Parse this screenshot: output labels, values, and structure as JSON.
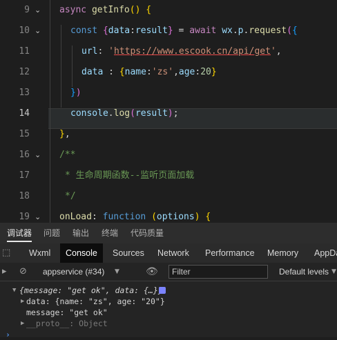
{
  "editor": {
    "lines": [
      {
        "number": "9",
        "segments": [
          [
            "kw",
            "async"
          ],
          [
            "plain",
            " "
          ],
          [
            "fn",
            "getInfo"
          ],
          [
            "br1",
            "()"
          ],
          [
            "plain",
            " "
          ],
          [
            "br1",
            "{"
          ]
        ]
      },
      {
        "number": "10",
        "segments": [
          [
            "kw2",
            "const"
          ],
          [
            "plain",
            " "
          ],
          [
            "br2",
            "{"
          ],
          [
            "var",
            "data"
          ],
          [
            "plain",
            ":"
          ],
          [
            "var",
            "result"
          ],
          [
            "br2",
            "}"
          ],
          [
            "plain",
            " = "
          ],
          [
            "kw",
            "await"
          ],
          [
            "plain",
            " "
          ],
          [
            "var",
            "wx"
          ],
          [
            "plain",
            "."
          ],
          [
            "var",
            "p"
          ],
          [
            "plain",
            "."
          ],
          [
            "fn",
            "request"
          ],
          [
            "br2",
            "("
          ],
          [
            "br3",
            "{"
          ]
        ]
      },
      {
        "number": "11",
        "segments": [
          [
            "var",
            "url"
          ],
          [
            "plain",
            ": "
          ],
          [
            "str",
            "'"
          ],
          [
            "url",
            "https://www.escook.cn/api/get"
          ],
          [
            "str",
            "'"
          ],
          [
            "plain",
            ","
          ]
        ]
      },
      {
        "number": "12",
        "segments": [
          [
            "var",
            "data"
          ],
          [
            "plain",
            " : "
          ],
          [
            "br1",
            "{"
          ],
          [
            "var",
            "name"
          ],
          [
            "plain",
            ":"
          ],
          [
            "str",
            "'zs'"
          ],
          [
            "plain",
            ","
          ],
          [
            "var",
            "age"
          ],
          [
            "plain",
            ":"
          ],
          [
            "num",
            "20"
          ],
          [
            "br1",
            "}"
          ]
        ]
      },
      {
        "number": "13",
        "segments": [
          [
            "br3",
            "}"
          ],
          [
            "br2",
            ")"
          ]
        ]
      },
      {
        "number": "14",
        "segments": [
          [
            "var",
            "console"
          ],
          [
            "plain",
            "."
          ],
          [
            "fn",
            "log"
          ],
          [
            "br2",
            "("
          ],
          [
            "var",
            "result"
          ],
          [
            "br2",
            ")"
          ],
          [
            "plain",
            ";"
          ]
        ]
      },
      {
        "number": "15",
        "segments": [
          [
            "br1",
            "}"
          ],
          [
            "plain",
            ","
          ]
        ]
      },
      {
        "number": "16",
        "segments": [
          [
            "cmt",
            "/**"
          ]
        ]
      },
      {
        "number": "17",
        "segments": [
          [
            "cmt",
            "* 生命周期函数--监听页面加载"
          ]
        ]
      },
      {
        "number": "18",
        "segments": [
          [
            "cmt",
            "*/"
          ]
        ]
      },
      {
        "number": "19",
        "segments": [
          [
            "fn",
            "onLoad"
          ],
          [
            "plain",
            ": "
          ],
          [
            "kw2",
            "function"
          ],
          [
            "plain",
            " "
          ],
          [
            "br1",
            "("
          ],
          [
            "var",
            "options"
          ],
          [
            "br1",
            ")"
          ],
          [
            "plain",
            " "
          ],
          [
            "br1",
            "{"
          ]
        ]
      }
    ]
  },
  "devtools": {
    "top_tabs": [
      "调试器",
      "问题",
      "输出",
      "终端",
      "代码质量"
    ],
    "panel_tabs": [
      "Wxml",
      "Console",
      "Sources",
      "Network",
      "Performance",
      "Memory",
      "AppDa"
    ],
    "active_panel": "Console",
    "context": "appservice (#34)",
    "filter_placeholder": "Filter",
    "levels": "Default levels",
    "console": {
      "summary": "{message: \"get ok\", data: {…}}",
      "data_line": "data: {name: \"zs\", age: \"20\"}",
      "message_line": "message: \"get ok\"",
      "proto_line": "__proto__: Object"
    }
  }
}
